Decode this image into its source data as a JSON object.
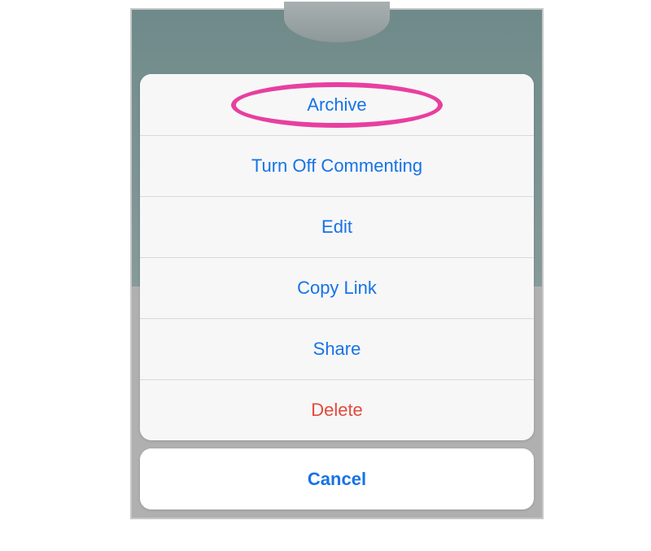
{
  "actions": {
    "archive": "Archive",
    "turnOffCommenting": "Turn Off Commenting",
    "edit": "Edit",
    "copyLink": "Copy Link",
    "share": "Share",
    "delete": "Delete"
  },
  "cancel": "Cancel",
  "highlightColor": "#e83fa0"
}
